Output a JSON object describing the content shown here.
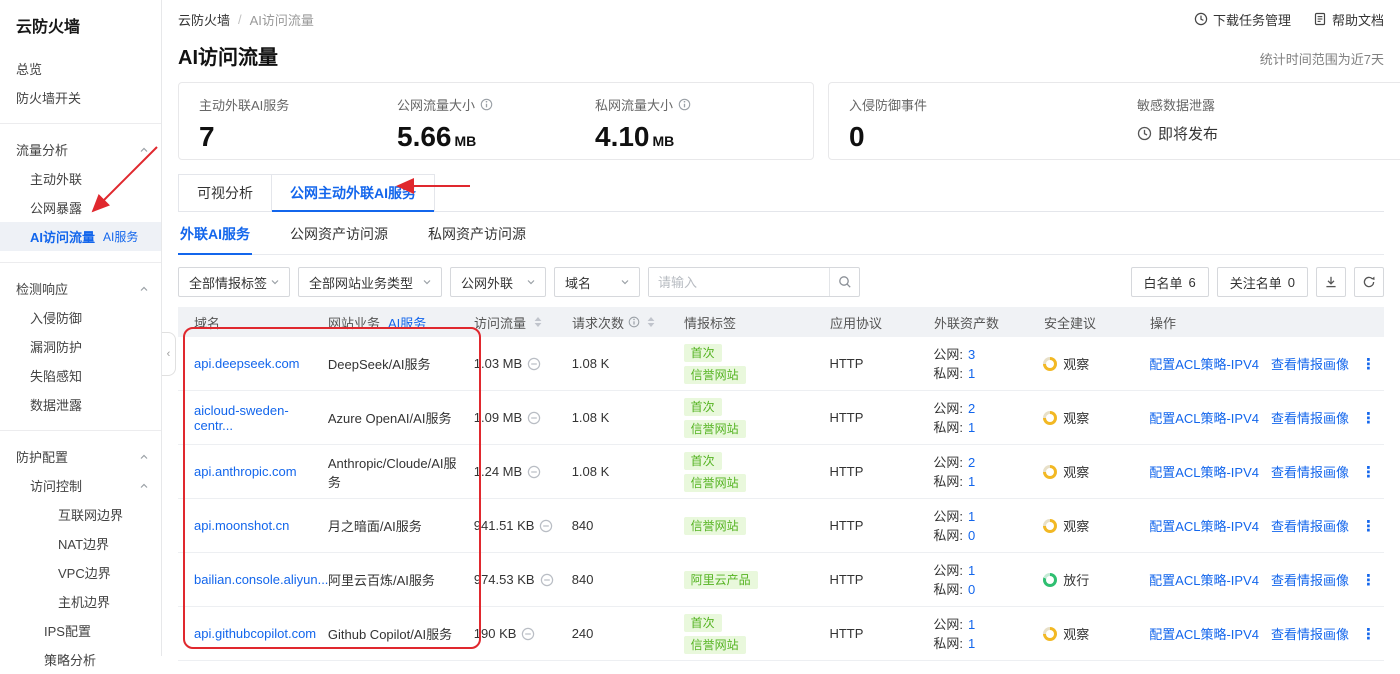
{
  "colors": {
    "primary": "#1366ec",
    "annotation": "#e0282e",
    "tag_green": "#55b322"
  },
  "sidebar": {
    "title": "云防火墙",
    "items": [
      {
        "label": "总览",
        "level": 0,
        "type": "item"
      },
      {
        "label": "防火墙开关",
        "level": 0,
        "type": "item"
      },
      {
        "type": "divider"
      },
      {
        "label": "流量分析",
        "level": 0,
        "type": "group"
      },
      {
        "label": "主动外联",
        "level": 1,
        "type": "item"
      },
      {
        "label": "公网暴露",
        "level": 1,
        "type": "item"
      },
      {
        "label": "AI访问流量",
        "level": 1,
        "type": "item",
        "active": true,
        "badge": "AI服务"
      },
      {
        "type": "divider"
      },
      {
        "label": "检测响应",
        "level": 0,
        "type": "group"
      },
      {
        "label": "入侵防御",
        "level": 1,
        "type": "item"
      },
      {
        "label": "漏洞防护",
        "level": 1,
        "type": "item"
      },
      {
        "label": "失陷感知",
        "level": 1,
        "type": "item"
      },
      {
        "label": "数据泄露",
        "level": 1,
        "type": "item"
      },
      {
        "type": "divider"
      },
      {
        "label": "防护配置",
        "level": 0,
        "type": "group"
      },
      {
        "label": "访问控制",
        "level": 1,
        "type": "group"
      },
      {
        "label": "互联网边界",
        "level": 3,
        "type": "item"
      },
      {
        "label": "NAT边界",
        "level": 3,
        "type": "item"
      },
      {
        "label": "VPC边界",
        "level": 3,
        "type": "item"
      },
      {
        "label": "主机边界",
        "level": 3,
        "type": "item"
      },
      {
        "label": "IPS配置",
        "level": 2,
        "type": "item"
      },
      {
        "label": "策略分析",
        "level": 2,
        "type": "item"
      }
    ]
  },
  "topbar": {
    "breadcrumb": [
      "云防火墙",
      "AI访问流量"
    ],
    "download_manager": "下载任务管理",
    "help_doc": "帮助文档"
  },
  "header": {
    "title": "AI访问流量",
    "time_range": "统计时间范围为近7天"
  },
  "stats": {
    "outbound_services": {
      "label": "主动外联AI服务",
      "value": "7"
    },
    "public_traffic": {
      "label": "公网流量大小",
      "value": "5.66",
      "unit": "MB"
    },
    "private_traffic": {
      "label": "私网流量大小",
      "value": "4.10",
      "unit": "MB"
    },
    "ips_events": {
      "label": "入侵防御事件",
      "value": "0"
    },
    "data_leak": {
      "label": "敏感数据泄露",
      "value": "即将发布"
    }
  },
  "tabs": [
    {
      "label": "可视分析",
      "active": false
    },
    {
      "label": "公网主动外联AI服务",
      "active": true
    }
  ],
  "subtabs": [
    {
      "label": "外联AI服务",
      "active": true
    },
    {
      "label": "公网资产访问源",
      "active": false
    },
    {
      "label": "私网资产访问源",
      "active": false
    }
  ],
  "filters": {
    "intel_tag": "全部情报标签",
    "site_type": "全部网站业务类型",
    "outbound_type": "公网外联",
    "search_field": "域名",
    "search_placeholder": "请输入",
    "whitelist_label": "白名单",
    "whitelist_count": "6",
    "watchlist_label": "关注名单",
    "watchlist_count": "0"
  },
  "table": {
    "columns": {
      "domain": "域名",
      "business": "网站业务",
      "business_filter": "AI服务",
      "traffic": "访问流量",
      "requests": "请求次数",
      "intel_tags": "情报标签",
      "protocol": "应用协议",
      "assets": "外联资产数",
      "advice": "安全建议",
      "actions": "操作"
    },
    "asset_labels": {
      "public": "公网:",
      "private": "私网:"
    },
    "action_labels": [
      "配置ACL策略-IPV4",
      "查看情报画像"
    ],
    "rows": [
      {
        "domain": "api.deepseek.com",
        "service": "DeepSeek/AI服务",
        "traffic": "1.03 MB",
        "requests": "1.08 K",
        "tags": [
          "首次",
          "信誉网站"
        ],
        "protocol": "HTTP",
        "public_count": "3",
        "private_count": "1",
        "advice": "观察",
        "advice_level": "warn"
      },
      {
        "domain": "aicloud-sweden-centr...",
        "service": "Azure OpenAI/AI服务",
        "traffic": "1.09 MB",
        "requests": "1.08 K",
        "tags": [
          "首次",
          "信誉网站"
        ],
        "protocol": "HTTP",
        "public_count": "2",
        "private_count": "1",
        "advice": "观察",
        "advice_level": "warn"
      },
      {
        "domain": "api.anthropic.com",
        "service": "Anthropic/Cloude/AI服务",
        "traffic": "1.24 MB",
        "requests": "1.08 K",
        "tags": [
          "首次",
          "信誉网站"
        ],
        "protocol": "HTTP",
        "public_count": "2",
        "private_count": "1",
        "advice": "观察",
        "advice_level": "warn"
      },
      {
        "domain": "api.moonshot.cn",
        "service": "月之暗面/AI服务",
        "traffic": "941.51 KB",
        "requests": "840",
        "tags": [
          "信誉网站"
        ],
        "protocol": "HTTP",
        "public_count": "1",
        "private_count": "0",
        "advice": "观察",
        "advice_level": "warn"
      },
      {
        "domain": "bailian.console.aliyun...",
        "service": "阿里云百炼/AI服务",
        "traffic": "974.53 KB",
        "requests": "840",
        "tags": [
          "阿里云产品"
        ],
        "protocol": "HTTP",
        "public_count": "1",
        "private_count": "0",
        "advice": "放行",
        "advice_level": "pass"
      },
      {
        "domain": "api.githubcopilot.com",
        "service": "Github Copilot/AI服务",
        "traffic": "190 KB",
        "requests": "240",
        "tags": [
          "首次",
          "信誉网站"
        ],
        "protocol": "HTTP",
        "public_count": "1",
        "private_count": "1",
        "advice": "观察",
        "advice_level": "warn"
      }
    ]
  }
}
